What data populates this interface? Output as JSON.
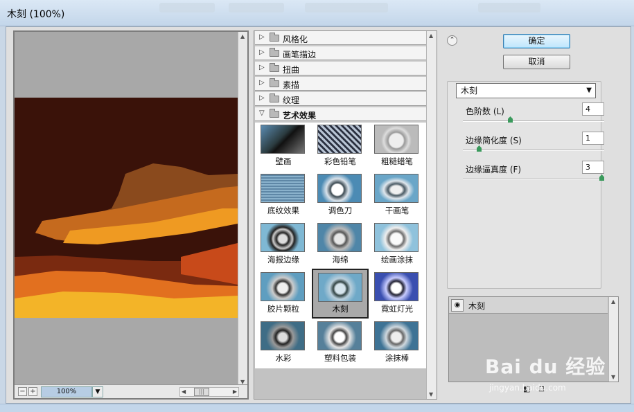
{
  "window": {
    "title": "木刻 (100%)"
  },
  "preview": {
    "zoom": "100%",
    "zoom_out": "−",
    "zoom_in": "+"
  },
  "categories": [
    {
      "label": "风格化",
      "open": false
    },
    {
      "label": "画笔描边",
      "open": false
    },
    {
      "label": "扭曲",
      "open": false
    },
    {
      "label": "素描",
      "open": false
    },
    {
      "label": "纹理",
      "open": false
    },
    {
      "label": "艺术效果",
      "open": true
    }
  ],
  "thumbnails": [
    {
      "label": "壁画"
    },
    {
      "label": "彩色铅笔"
    },
    {
      "label": "粗糙蜡笔"
    },
    {
      "label": "底纹效果"
    },
    {
      "label": "调色刀"
    },
    {
      "label": "干画笔"
    },
    {
      "label": "海报边缘"
    },
    {
      "label": "海绵"
    },
    {
      "label": "绘画涂抹"
    },
    {
      "label": "胶片颗粒"
    },
    {
      "label": "木刻",
      "selected": true
    },
    {
      "label": "霓虹灯光"
    },
    {
      "label": "水彩"
    },
    {
      "label": "塑料包装"
    },
    {
      "label": "涂抹棒"
    }
  ],
  "buttons": {
    "ok": "确定",
    "cancel": "取消"
  },
  "settings": {
    "filter": "木刻",
    "params": [
      {
        "label": "色阶数 (L)",
        "value": "4",
        "level": 0.33
      },
      {
        "label": "边缘简化度 (S)",
        "value": "1",
        "level": 0.1
      },
      {
        "label": "边缘逼真度 (F)",
        "value": "3",
        "level": 1.0
      }
    ]
  },
  "layers": {
    "name": "木刻"
  },
  "watermark": {
    "brand": "Bai du 经验",
    "url": "jingyan.baidu.com"
  }
}
